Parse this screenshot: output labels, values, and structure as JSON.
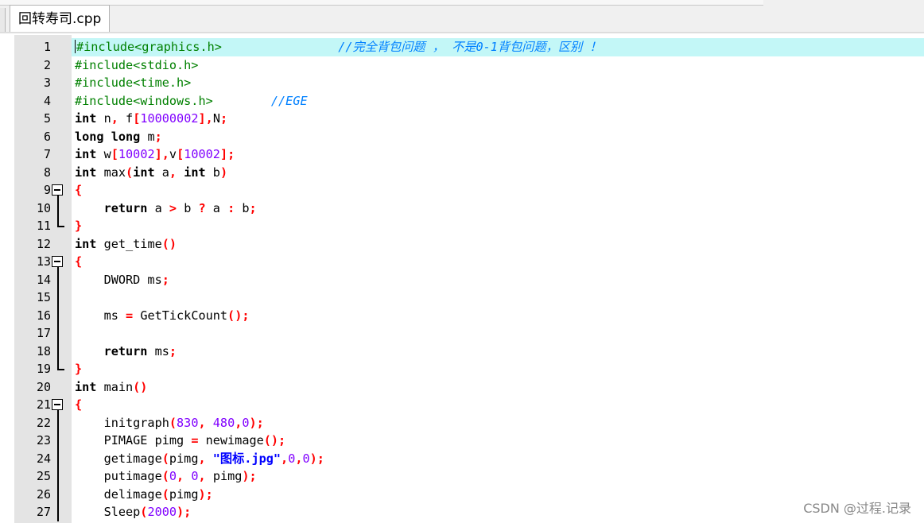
{
  "tab": {
    "label": "回转寿司.cpp"
  },
  "watermark": "CSDN @过程.记录",
  "colors": {
    "current_line": "#c3f7f7",
    "preprocessor": "#008000",
    "operator": "#ff0000",
    "number": "#8000ff",
    "comment": "#0080ff",
    "string": "#0000ff"
  },
  "lines": [
    {
      "n": "1",
      "fold": "",
      "current": true,
      "t": [
        [
          "pp",
          "#include<graphics.h>"
        ],
        [
          "",
          "                "
        ],
        [
          "cm",
          "//完全背包问题 ， 不是0-1背包问题，区别 ！"
        ]
      ]
    },
    {
      "n": "2",
      "fold": "",
      "t": [
        [
          "pp",
          "#include<stdio.h>"
        ]
      ]
    },
    {
      "n": "3",
      "fold": "",
      "t": [
        [
          "pp",
          "#include<time.h>"
        ]
      ]
    },
    {
      "n": "4",
      "fold": "",
      "t": [
        [
          "pp",
          "#include<windows.h>"
        ],
        [
          "",
          "        "
        ],
        [
          "cm",
          "//EGE"
        ]
      ]
    },
    {
      "n": "5",
      "fold": "",
      "t": [
        [
          "kw",
          "int"
        ],
        [
          "",
          " n"
        ],
        [
          "op",
          ","
        ],
        [
          "",
          " f"
        ],
        [
          "op",
          "["
        ],
        [
          "num-c",
          "10000002"
        ],
        [
          "op",
          "]"
        ],
        [
          "op",
          ","
        ],
        [
          "",
          "N"
        ],
        [
          "op",
          ";"
        ]
      ]
    },
    {
      "n": "6",
      "fold": "",
      "t": [
        [
          "kw",
          "long long"
        ],
        [
          "",
          " m"
        ],
        [
          "op",
          ";"
        ]
      ]
    },
    {
      "n": "7",
      "fold": "",
      "t": [
        [
          "kw",
          "int"
        ],
        [
          "",
          " w"
        ],
        [
          "op",
          "["
        ],
        [
          "num-c",
          "10002"
        ],
        [
          "op",
          "]"
        ],
        [
          "op",
          ","
        ],
        [
          "",
          "v"
        ],
        [
          "op",
          "["
        ],
        [
          "num-c",
          "10002"
        ],
        [
          "op",
          "]"
        ],
        [
          "op",
          ";"
        ]
      ]
    },
    {
      "n": "8",
      "fold": "",
      "t": [
        [
          "kw",
          "int"
        ],
        [
          "",
          " max"
        ],
        [
          "op",
          "("
        ],
        [
          "kw",
          "int"
        ],
        [
          "",
          " a"
        ],
        [
          "op",
          ","
        ],
        [
          "",
          ""
        ],
        [
          "kw",
          " int"
        ],
        [
          "",
          " b"
        ],
        [
          "op",
          ")"
        ]
      ]
    },
    {
      "n": "9",
      "fold": "open",
      "t": [
        [
          "op",
          "{"
        ]
      ]
    },
    {
      "n": "10",
      "fold": "mid",
      "t": [
        [
          "",
          "    "
        ],
        [
          "kw",
          "return"
        ],
        [
          "",
          " a "
        ],
        [
          "op",
          ">"
        ],
        [
          "",
          " b "
        ],
        [
          "op",
          "?"
        ],
        [
          "",
          " a "
        ],
        [
          "op",
          ":"
        ],
        [
          "",
          " b"
        ],
        [
          "op",
          ";"
        ]
      ]
    },
    {
      "n": "11",
      "fold": "end",
      "t": [
        [
          "op",
          "}"
        ]
      ]
    },
    {
      "n": "12",
      "fold": "",
      "t": [
        [
          "kw",
          "int"
        ],
        [
          "",
          " get_time"
        ],
        [
          "op",
          "()"
        ]
      ]
    },
    {
      "n": "13",
      "fold": "open",
      "t": [
        [
          "op",
          "{"
        ]
      ]
    },
    {
      "n": "14",
      "fold": "mid",
      "t": [
        [
          "",
          "    DWORD ms"
        ],
        [
          "op",
          ";"
        ]
      ]
    },
    {
      "n": "15",
      "fold": "mid",
      "t": []
    },
    {
      "n": "16",
      "fold": "mid",
      "t": [
        [
          "",
          "    ms "
        ],
        [
          "op",
          "="
        ],
        [
          "",
          " GetTickCount"
        ],
        [
          "op",
          "();"
        ]
      ]
    },
    {
      "n": "17",
      "fold": "mid",
      "t": []
    },
    {
      "n": "18",
      "fold": "mid",
      "t": [
        [
          "",
          "    "
        ],
        [
          "kw",
          "return"
        ],
        [
          "",
          " ms"
        ],
        [
          "op",
          ";"
        ]
      ]
    },
    {
      "n": "19",
      "fold": "end",
      "t": [
        [
          "op",
          "}"
        ]
      ]
    },
    {
      "n": "20",
      "fold": "",
      "t": [
        [
          "kw",
          "int"
        ],
        [
          "",
          " main"
        ],
        [
          "op",
          "()"
        ]
      ]
    },
    {
      "n": "21",
      "fold": "open",
      "t": [
        [
          "op",
          "{"
        ]
      ]
    },
    {
      "n": "22",
      "fold": "mid",
      "t": [
        [
          "",
          "    initgraph"
        ],
        [
          "op",
          "("
        ],
        [
          "num-c",
          "830"
        ],
        [
          "op",
          ","
        ],
        [
          "",
          " "
        ],
        [
          "num-c",
          "480"
        ],
        [
          "op",
          ","
        ],
        [
          "num-c",
          "0"
        ],
        [
          "op",
          ");"
        ]
      ]
    },
    {
      "n": "23",
      "fold": "mid",
      "t": [
        [
          "",
          "    PIMAGE pimg "
        ],
        [
          "op",
          "="
        ],
        [
          "",
          " newimage"
        ],
        [
          "op",
          "();"
        ]
      ]
    },
    {
      "n": "24",
      "fold": "mid",
      "t": [
        [
          "",
          "    getimage"
        ],
        [
          "op",
          "("
        ],
        [
          "",
          "pimg"
        ],
        [
          "op",
          ","
        ],
        [
          "",
          " "
        ],
        [
          "str",
          "\"图标.jpg\""
        ],
        [
          "op",
          ","
        ],
        [
          "num-c",
          "0"
        ],
        [
          "op",
          ","
        ],
        [
          "num-c",
          "0"
        ],
        [
          "op",
          ");"
        ]
      ]
    },
    {
      "n": "25",
      "fold": "mid",
      "t": [
        [
          "",
          "    putimage"
        ],
        [
          "op",
          "("
        ],
        [
          "num-c",
          "0"
        ],
        [
          "op",
          ","
        ],
        [
          "",
          " "
        ],
        [
          "num-c",
          "0"
        ],
        [
          "op",
          ","
        ],
        [
          "",
          " pimg"
        ],
        [
          "op",
          ");"
        ]
      ]
    },
    {
      "n": "26",
      "fold": "mid",
      "t": [
        [
          "",
          "    delimage"
        ],
        [
          "op",
          "("
        ],
        [
          "",
          "pimg"
        ],
        [
          "op",
          ");"
        ]
      ]
    },
    {
      "n": "27",
      "fold": "mid",
      "t": [
        [
          "",
          "    Sleep"
        ],
        [
          "op",
          "("
        ],
        [
          "num-c",
          "2000"
        ],
        [
          "op",
          ");"
        ]
      ]
    }
  ]
}
